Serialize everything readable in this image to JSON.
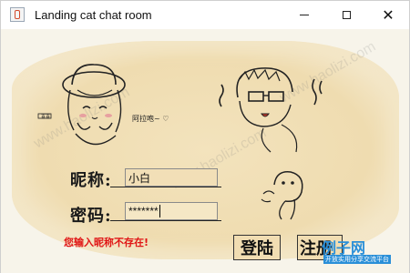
{
  "window": {
    "title": "Landing cat chat room",
    "controls": {
      "minimize": "minimize",
      "maximize": "maximize",
      "close": "✕"
    }
  },
  "doodles": {
    "left_tag": "喜喜",
    "right_tag": "阿拉咆~ ♡"
  },
  "form": {
    "nickname_label": "昵称:",
    "nickname_value": "小白",
    "password_label": "密码:",
    "password_value": "*******",
    "error_message": "您输入昵称不存在!"
  },
  "buttons": {
    "login_label": "登陆",
    "register_label": "注册"
  },
  "watermark": {
    "text": "www.haolizi.com",
    "logo_main": "例子网",
    "logo_sub": "开放实用分享交流平台",
    "logo_color": "#2a8fd8"
  },
  "colors": {
    "parchment": "#efdcb0",
    "error": "#e01515",
    "field_bg": "#f2dfb7"
  }
}
